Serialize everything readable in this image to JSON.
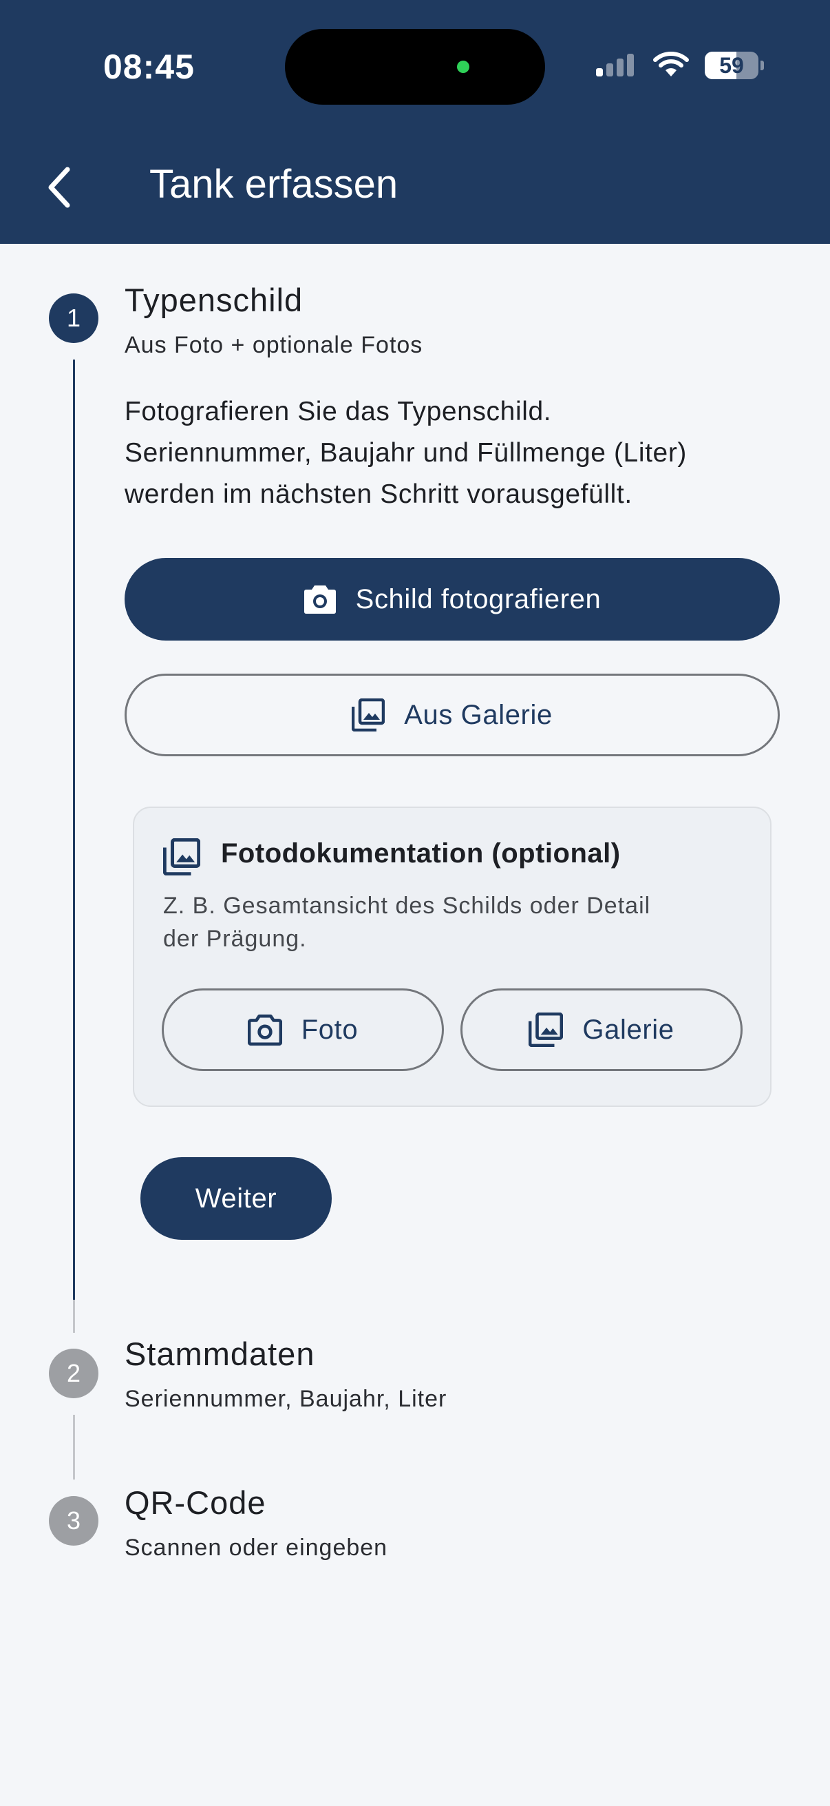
{
  "status_bar": {
    "time": "08:45",
    "battery": "59",
    "battery_level_percent": 59
  },
  "app_bar": {
    "title": "Tank erfassen",
    "back_icon": "chevron-left-icon"
  },
  "steps": [
    {
      "number": "1",
      "title": "Typenschild",
      "subtitle": "Aus Foto + optionale Fotos",
      "state": "active"
    },
    {
      "number": "2",
      "title": "Stammdaten",
      "subtitle": "Seriennummer, Baujahr, Liter",
      "state": "inactive"
    },
    {
      "number": "3",
      "title": "QR-Code",
      "subtitle": "Scannen oder eingeben",
      "state": "inactive"
    }
  ],
  "step1": {
    "intro_lines": [
      "Fotografieren Sie das Typenschild.",
      "Seriennummer, Baujahr und Füllmenge (Liter)",
      "werden im nächsten Schritt vorausgefüllt."
    ],
    "take_photo_label": "Schild fotografieren",
    "take_photo_icon": "camera-icon",
    "gallery_label": "Aus Galerie",
    "gallery_icon": "gallery-icon",
    "photo_doc": {
      "title": "Fotodokumentation (optional)",
      "description_lines": [
        "Z. B. Gesamtansicht des Schilds oder Detail",
        "der Prägung."
      ],
      "photo_label": "Foto",
      "gallery_label": "Galerie"
    },
    "next_label": "Weiter"
  },
  "colors": {
    "primary": "#1f3a60",
    "background": "#f4f6f9",
    "inactive_step": "#9d9fa3",
    "card_background": "#edf0f4",
    "outline": "#74777c"
  }
}
